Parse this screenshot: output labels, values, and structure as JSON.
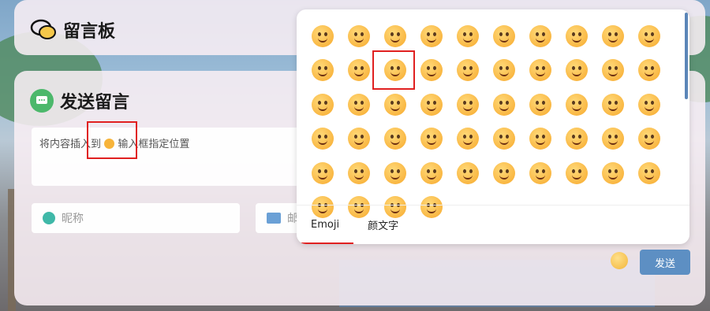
{
  "board": {
    "title": "留言板"
  },
  "form": {
    "title": "发送留言",
    "textarea_text_before": "将内容插",
    "textarea_text_middle": "入到",
    "textarea_text_after": "输入框指定位置",
    "nickname_placeholder": "昵称",
    "email_placeholder": "邮"
  },
  "emoji_panel": {
    "tabs": [
      "Emoji",
      "颜文字"
    ],
    "active_tab": "Emoji",
    "emoji_count": 54
  },
  "actions": {
    "send_label": "发送"
  },
  "colors": {
    "accent": "#5d8fc3",
    "highlight": "#e02020",
    "green": "#4cb86b"
  }
}
